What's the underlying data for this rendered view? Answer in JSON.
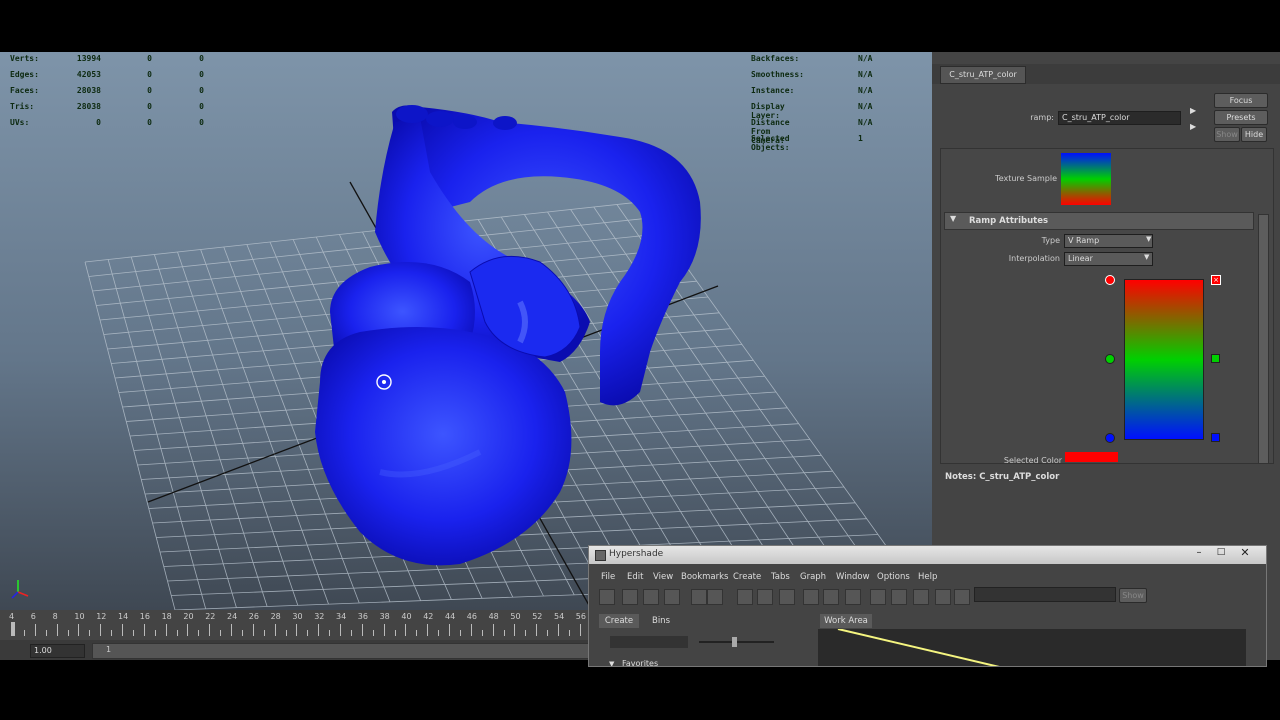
{
  "hud_left": [
    {
      "label": "Verts:",
      "v1": "13994",
      "v2": "0",
      "v3": "0"
    },
    {
      "label": "Edges:",
      "v1": "42053",
      "v2": "0",
      "v3": "0"
    },
    {
      "label": "Faces:",
      "v1": "28038",
      "v2": "0",
      "v3": "0"
    },
    {
      "label": "Tris:",
      "v1": "28038",
      "v2": "0",
      "v3": "0"
    },
    {
      "label": "UVs:",
      "v1": "0",
      "v2": "0",
      "v3": "0"
    }
  ],
  "hud_right": [
    {
      "label": "Backfaces:",
      "value": "N/A"
    },
    {
      "label": "Smoothness:",
      "value": "N/A"
    },
    {
      "label": "Instance:",
      "value": "N/A"
    },
    {
      "label": "Display Layer:",
      "value": "N/A"
    },
    {
      "label": "Distance From Camera:",
      "value": "N/A"
    },
    {
      "label": "Selected Objects:",
      "value": "1"
    }
  ],
  "timeline": {
    "ticks": [
      "4",
      "6",
      "8",
      "10",
      "12",
      "14",
      "16",
      "18",
      "20",
      "22",
      "24",
      "26",
      "28",
      "30",
      "32",
      "34",
      "36",
      "38",
      "40",
      "42",
      "44",
      "46",
      "48",
      "50",
      "52",
      "54",
      "56"
    ],
    "start_value": "1.00",
    "current": "1"
  },
  "attr_editor": {
    "tab": "C_stru_ATP_color",
    "ramp_label": "ramp:",
    "ramp_value": "C_stru_ATP_color",
    "focus": "Focus",
    "presets": "Presets",
    "show": "Show",
    "hide": "Hide",
    "texture_sample": "Texture Sample",
    "section": "Ramp Attributes",
    "type_label": "Type",
    "type_value": "V Ramp",
    "interp_label": "Interpolation",
    "interp_value": "Linear",
    "selected_color": "Selected Color",
    "notes": "Notes: C_stru_ATP_color",
    "colors": {
      "red": "#ff0000",
      "green": "#00d000",
      "blue": "#0010ff"
    }
  },
  "hypershade": {
    "title": "Hypershade",
    "menu": [
      "File",
      "Edit",
      "View",
      "Bookmarks",
      "Create",
      "Tabs",
      "Graph",
      "Window",
      "Options",
      "Help"
    ],
    "show": "Show",
    "tabs": [
      "Create",
      "Bins"
    ],
    "work_area": "Work Area",
    "favorites": "Favorites"
  }
}
